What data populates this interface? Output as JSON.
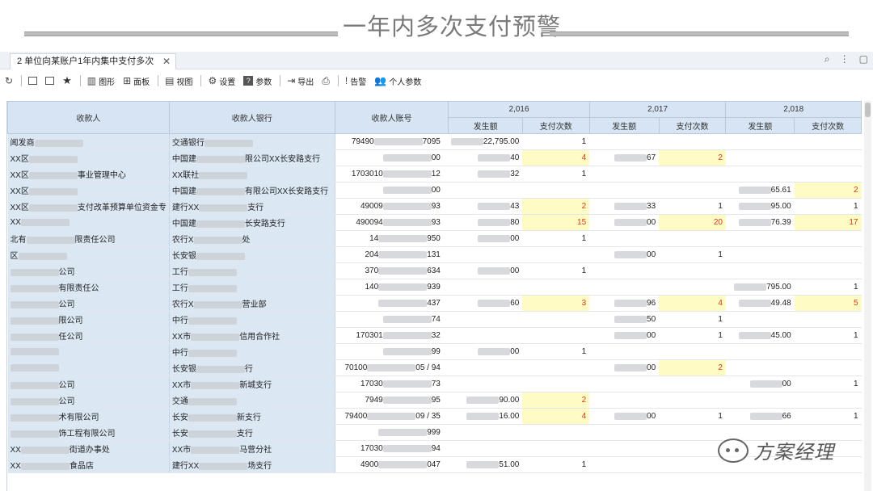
{
  "page": {
    "title": "一年内多次支付预警"
  },
  "tab": {
    "label": "2 单位向某账户1年内集中支付多次"
  },
  "toolbar": {
    "items": [
      "图形",
      "面板",
      "视图",
      "设置",
      "参数",
      "导出",
      "告警",
      "个人参数"
    ]
  },
  "table": {
    "headers": {
      "payee": "收款人",
      "bank": "收款人银行",
      "account": "收款人账号",
      "amount": "发生额",
      "count": "支付次数"
    },
    "years": [
      "2,016",
      "2,017",
      "2,018"
    ],
    "rows": [
      {
        "name": "闻发商",
        "bank": "交通银行",
        "acct": "79490",
        "acct_end": "7095",
        "y16a": "22,795.00",
        "y16c": "1",
        "y17a": "",
        "y17c": "",
        "y18a": "",
        "y18c": ""
      },
      {
        "name": "XX区",
        "bank": "中国建",
        "bank_end": "限公司XX长安路支行",
        "acct": "",
        "acct_end": "00",
        "y16a": "40",
        "y16c": "4",
        "y17a": "67",
        "y17c": "2",
        "y18a": "",
        "y18c": ""
      },
      {
        "name": "XX区",
        "name_end": "事业管理中心",
        "bank": "XX联社",
        "acct": "1703010",
        "acct_end": "12",
        "y16a": "32",
        "y16c": "1",
        "y17a": "",
        "y17c": "",
        "y18a": "",
        "y18c": ""
      },
      {
        "name": "XX区",
        "bank": "中国建",
        "bank_end": "有限公司XX长安路支行",
        "acct": "",
        "acct_end": "00",
        "y16a": "",
        "y16c": "",
        "y17a": "",
        "y17c": "",
        "y18a": "65.61",
        "y18c": "2"
      },
      {
        "name": "XX区",
        "name_end": "支付改革预算单位资金专",
        "bank": "建行XX",
        "bank_end": "支行",
        "acct": "49009",
        "acct_end": "93",
        "y16a": "43",
        "y16c": "2",
        "y17a": "33",
        "y17c": "1",
        "y18a": "95.00",
        "y18c": "1"
      },
      {
        "name": "XX",
        "bank": "中国建",
        "bank_end": "长安路支行",
        "acct": "490094",
        "acct_end": "93",
        "y16a": "80",
        "y16c": "15",
        "y17a": "00",
        "y17c": "20",
        "y18a": "76.39",
        "y18c": "17"
      },
      {
        "name": "北有",
        "name_end": "限责任公司",
        "bank": "农行X",
        "bank_end": "处",
        "acct": "14",
        "acct_end": "950",
        "y16a": "00",
        "y16c": "1",
        "y17a": "",
        "y17c": "",
        "y18a": "",
        "y18c": ""
      },
      {
        "name": "区",
        "bank": "长安银",
        "bank_end": "",
        "acct": "204",
        "acct_end": "131",
        "y16a": "",
        "y16c": "",
        "y17a": "00",
        "y17c": "1",
        "y18a": "",
        "y18c": ""
      },
      {
        "name": "",
        "name_end": "公司",
        "bank": "工行",
        "acct": "370",
        "acct_end": "634",
        "y16a": "00",
        "y16c": "1",
        "y17a": "",
        "y17c": "",
        "y18a": "",
        "y18c": ""
      },
      {
        "name": "",
        "name_end": "有限责任公",
        "bank": "工行",
        "acct": "140",
        "acct_end": "939",
        "y16a": "",
        "y16c": "",
        "y17a": "",
        "y17c": "",
        "y18a": "795.00",
        "y18c": "1"
      },
      {
        "name": "",
        "name_end": "公司",
        "bank": "农行X",
        "bank_end": "营业部",
        "acct": "",
        "acct_end": "437",
        "y16a": "60",
        "y16c": "3",
        "y17a": "96",
        "y17c": "4",
        "y18a": "49.48",
        "y18c": "5"
      },
      {
        "name": "",
        "name_end": "限公司",
        "bank": "中行",
        "acct": "",
        "acct_end": "74",
        "y16a": "",
        "y16c": "",
        "y17a": "50",
        "y17c": "1",
        "y18a": "",
        "y18c": ""
      },
      {
        "name": "",
        "name_end": "任公司",
        "bank": "XX市",
        "bank_end": "信用合作社",
        "acct": "170301",
        "acct_end": "32",
        "y16a": "",
        "y16c": "",
        "y17a": "00",
        "y17c": "1",
        "y18a": "45.00",
        "y18c": "1"
      },
      {
        "name": "",
        "bank": "中行",
        "acct": "",
        "acct_end": "99",
        "y16a": "00",
        "y16c": "1",
        "y17a": "",
        "y17c": "",
        "y18a": "",
        "y18c": ""
      },
      {
        "name": "",
        "bank": "长安银",
        "bank_end": "行",
        "acct": "70100",
        "acct_end": "05 / 94",
        "y16a": "",
        "y16c": "",
        "y17a": "00",
        "y17c": "2",
        "y18a": "",
        "y18c": ""
      },
      {
        "name": "",
        "name_end": "公司",
        "bank": "XX市",
        "bank_end": "新城支行",
        "acct": "17030",
        "acct_end": "73",
        "y16a": "",
        "y16c": "",
        "y17a": "",
        "y17c": "",
        "y18a": "00",
        "y18c": "1"
      },
      {
        "name": "",
        "name_end": "公司",
        "bank": "交通",
        "acct": "7949",
        "acct_end": "95",
        "y16a": "90.00",
        "y16c": "2",
        "y17a": "",
        "y17c": "",
        "y18a": "",
        "y18c": ""
      },
      {
        "name": "",
        "name_end": "术有限公司",
        "bank": "长安",
        "bank_end": "新支行",
        "acct": "79400",
        "acct_end": "09 / 35",
        "y16a": "16.00",
        "y16c": "4",
        "y17a": "00",
        "y17c": "1",
        "y18a": "66",
        "y18c": "1"
      },
      {
        "name": "",
        "name_end": "饰工程有限公司",
        "bank": "长安",
        "bank_end": "支行",
        "acct": "",
        "acct_end": "999",
        "y16a": "",
        "y16c": "",
        "y17a": "",
        "y17c": "",
        "y18a": "",
        "y18c": ""
      },
      {
        "name": "XX",
        "name_end": "街道办事处",
        "bank": "XX市",
        "bank_end": "马营分社",
        "acct": "17030",
        "acct_end": "94",
        "y16a": "",
        "y16c": "",
        "y17a": "",
        "y17c": "",
        "y18a": "",
        "y18c": ""
      },
      {
        "name": "XX",
        "name_end": "食品店",
        "bank": "建行XX",
        "bank_end": "场支行",
        "acct": "4900",
        "acct_end": "047",
        "y16a": "51.00",
        "y16c": "1",
        "y17a": "",
        "y17c": "",
        "y18a": "",
        "y18c": ""
      }
    ],
    "highlights": [
      [
        1,
        "y16c"
      ],
      [
        1,
        "y17c"
      ],
      [
        3,
        "y18c"
      ],
      [
        4,
        "y16c"
      ],
      [
        5,
        "y16c"
      ],
      [
        5,
        "y17c"
      ],
      [
        5,
        "y18c"
      ],
      [
        10,
        "y16c"
      ],
      [
        10,
        "y17c"
      ],
      [
        10,
        "y18c"
      ],
      [
        14,
        "y17c"
      ],
      [
        16,
        "y16c"
      ],
      [
        17,
        "y16c"
      ]
    ]
  },
  "watermark": {
    "text": "方案经理"
  }
}
